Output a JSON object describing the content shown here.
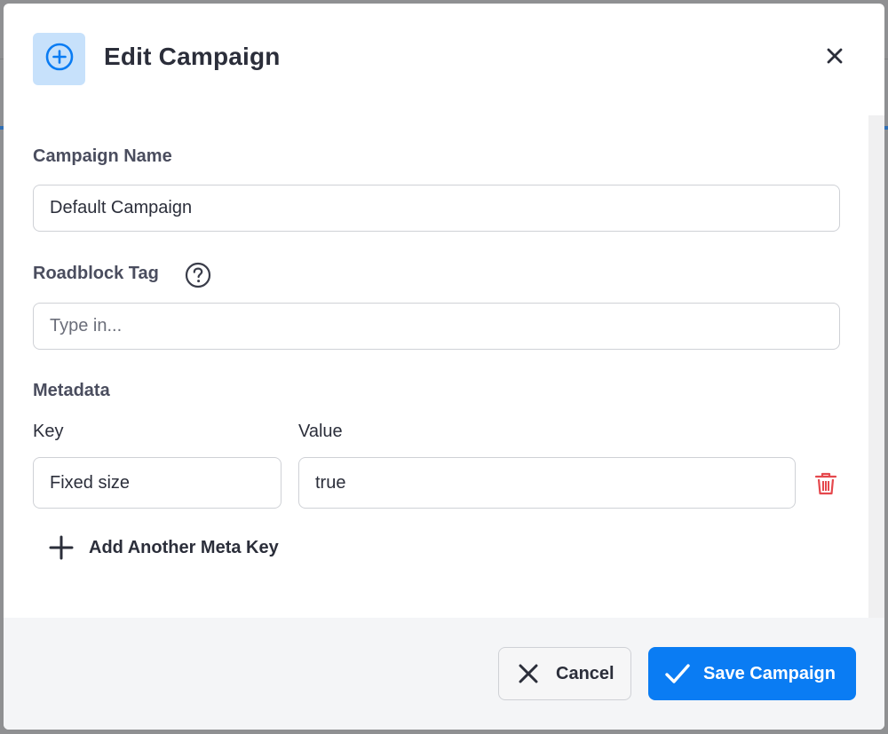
{
  "modal": {
    "title": "Edit Campaign",
    "header_icon": "plus-circle-icon",
    "close_icon": "close-icon"
  },
  "form": {
    "campaign_name": {
      "label": "Campaign Name",
      "value": "Default Campaign"
    },
    "roadblock_tag": {
      "label": "Roadblock Tag",
      "placeholder": "Type in...",
      "help_icon": "help-circle-icon"
    },
    "metadata": {
      "label": "Metadata",
      "key_label": "Key",
      "value_label": "Value",
      "rows": [
        {
          "key": "Fixed size",
          "value": "true",
          "delete_icon": "trash-icon"
        }
      ],
      "add_label": "Add Another Meta Key",
      "add_icon": "plus-icon"
    }
  },
  "footer": {
    "cancel_label": "Cancel",
    "cancel_icon": "close-icon",
    "save_label": "Save Campaign",
    "save_icon": "check-icon"
  },
  "colors": {
    "accent": "#0a7cf3",
    "icon_tile": "#c7e1fb",
    "delete": "#e5484d",
    "text": "#2b2e3a",
    "label": "#4a4d5e"
  }
}
